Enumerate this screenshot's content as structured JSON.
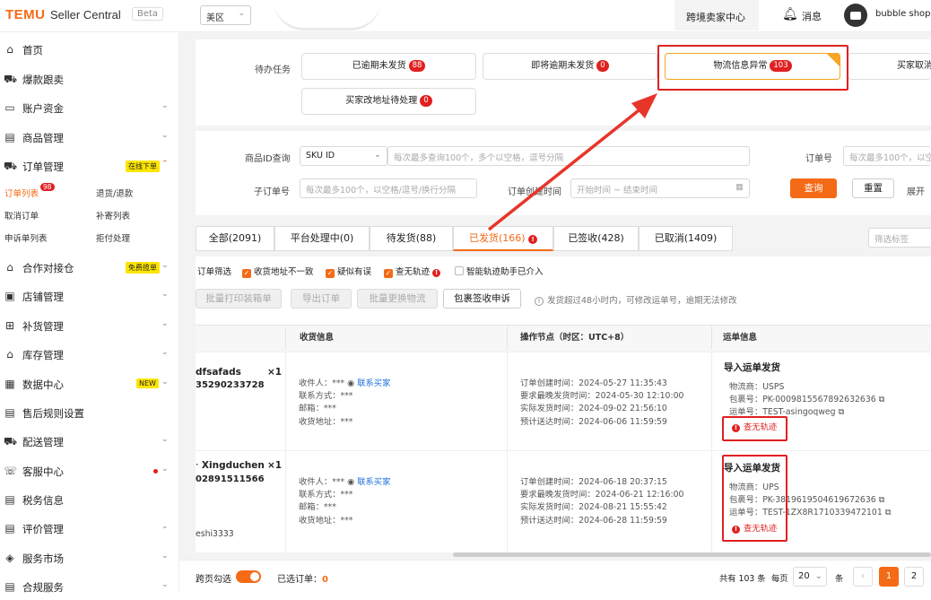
{
  "header": {
    "logo": "TEMU",
    "title": "Seller Central",
    "beta": "Beta",
    "region": "美区",
    "cross_border": "跨境卖家中心",
    "messages": "消息",
    "shop": "bubble shops"
  },
  "sidebar": {
    "items": [
      {
        "label": "首页",
        "icon": "home-icon",
        "glyph": "⌂"
      },
      {
        "label": "爆款跟卖",
        "icon": "cart-icon",
        "glyph": "⛟"
      },
      {
        "label": "账户资金",
        "icon": "wallet-icon",
        "glyph": "▭"
      },
      {
        "label": "商品管理",
        "icon": "product-icon",
        "glyph": "▤"
      },
      {
        "label": "订单管理",
        "icon": "order-cart-icon",
        "glyph": "⛟",
        "badge": "在线下单"
      },
      {
        "label": "合作对接仓",
        "icon": "warehouse-icon",
        "glyph": "⌂",
        "badge": "免费揽单"
      },
      {
        "label": "店铺管理",
        "icon": "store-icon",
        "glyph": "▣"
      },
      {
        "label": "补货管理",
        "icon": "restock-icon",
        "glyph": "⊞"
      },
      {
        "label": "库存管理",
        "icon": "inventory-icon",
        "glyph": "⌂"
      },
      {
        "label": "数据中心",
        "icon": "data-icon",
        "glyph": "▦",
        "badge": "NEW"
      },
      {
        "label": "售后规则设置",
        "icon": "aftersale-icon",
        "glyph": "▤"
      },
      {
        "label": "配送管理",
        "icon": "truck-icon",
        "glyph": "⛟"
      },
      {
        "label": "客服中心",
        "icon": "support-icon",
        "glyph": "☏"
      },
      {
        "label": "税务信息",
        "icon": "tax-icon",
        "glyph": "▤"
      },
      {
        "label": "评价管理",
        "icon": "review-icon",
        "glyph": "▤"
      },
      {
        "label": "服务市场",
        "icon": "market-icon",
        "glyph": "◈"
      },
      {
        "label": "合规服务",
        "icon": "compliance-icon",
        "glyph": "▤"
      }
    ],
    "order_sub": {
      "list": "订单列表",
      "list_count": "98",
      "returns": "退货/退款",
      "cancel": "取消订单",
      "resend": "补寄列表",
      "claims": "申诉单列表",
      "reject": "拒付处理"
    }
  },
  "tasks": {
    "label": "待办任务",
    "items": [
      {
        "label": "已逾期未发货",
        "count": "88"
      },
      {
        "label": "即将逾期未发货",
        "count": "0"
      },
      {
        "label": "物流信息异常",
        "count": "103"
      },
      {
        "label": "买家取消",
        "count": ""
      },
      {
        "label": "买家改地址待处理",
        "count": "0"
      }
    ]
  },
  "filters": {
    "product_id_label": "商品ID查询",
    "sku_select": "SKU ID",
    "sku_placeholder": "每次最多查询100个，多个以空格，逗号分隔",
    "order_no_label": "订单号",
    "order_no_placeholder": "每次最多100个，以空",
    "sub_order_label": "子订单号",
    "sub_order_placeholder": "每次最多100个，以空格/逗号/换行分隔",
    "created_label": "订单创建时间",
    "date_start": "开始时间",
    "date_sep": "~",
    "date_end": "结束时间",
    "search": "查询",
    "reset": "重置",
    "expand": "展开"
  },
  "tabs": [
    {
      "label": "全部(2091)"
    },
    {
      "label": "平台处理中(0)"
    },
    {
      "label": "待发货(88)"
    },
    {
      "label": "已发货(166)"
    },
    {
      "label": "已签收(428)"
    },
    {
      "label": "已取消(1409)"
    }
  ],
  "tab_filter_placeholder": "筛选标签",
  "order_filter": {
    "label": "订单筛选",
    "options": [
      {
        "label": "收货地址不一致",
        "checked": true
      },
      {
        "label": "疑似有误",
        "checked": true
      },
      {
        "label": "查无轨迹",
        "checked": true
      },
      {
        "label": "智能轨迹助手已介入",
        "checked": false
      }
    ]
  },
  "actions": {
    "batch_print": "批量打印装箱单",
    "export": "导出订单",
    "batch_change": "批量更换物流",
    "appeal": "包裹签收申诉",
    "notice": "发货超过48小时内，可修改运单号，逾期无法修改"
  },
  "table": {
    "headers": [
      "收货信息",
      "操作节点（时区：UTC+8）",
      "运单信息"
    ],
    "rows": [
      {
        "name": "dfsafads",
        "qty": "×1",
        "id": "35290233728",
        "extra": "",
        "recipient": "收件人：***",
        "contact_buyer": "联系买家",
        "contact": "联系方式：***",
        "email": "邮箱：***",
        "address": "收货地址：***",
        "created": "订单创建时间：2024-05-27 11:35:43",
        "deadline": "要求最晚发货时间：2024-05-30 12:10:00",
        "shipped": "实际发货时间：2024-09-02 21:56:10",
        "eta": "预计送达时间：2024-06-06 11:59:59",
        "ship_title": "导入运单发货",
        "carrier": "物流商：USPS",
        "package": "包裹号：PK-0009815567892632636",
        "tracking": "运单号：TEST-asingoqweg",
        "status": "查无轨迹"
      },
      {
        "name": "Xingduchen",
        "qty": "×1",
        "id": "02891511566",
        "extra": "eshi3333",
        "recipient": "收件人：***",
        "contact_buyer": "联系买家",
        "contact": "联系方式：***",
        "email": "邮箱：***",
        "address": "收货地址：***",
        "created": "订单创建时间：2024-06-18 20:37:15",
        "deadline": "要求最晚发货时间：2024-06-21 12:16:00",
        "shipped": "实际发货时间：2024-08-21 15:55:42",
        "eta": "预计送达时间：2024-06-28 11:59:59",
        "ship_title": "导入运单发货",
        "carrier": "物流商：UPS",
        "package": "包裹号：PK-3819619504619672636",
        "tracking": "运单号：TEST-1ZX8R1710339472101",
        "status": "查无轨迹"
      }
    ]
  },
  "footer": {
    "cross_page": "跨页勾选",
    "selected_label": "已选订单：",
    "selected": "0",
    "total": "共有 103 条",
    "per_page_label": "每页",
    "per_page": "20",
    "unit": "条",
    "prev": "‹",
    "pages": [
      "1",
      "2"
    ]
  },
  "colors": {
    "brand": "#f46a16",
    "alert": "#e02020"
  }
}
